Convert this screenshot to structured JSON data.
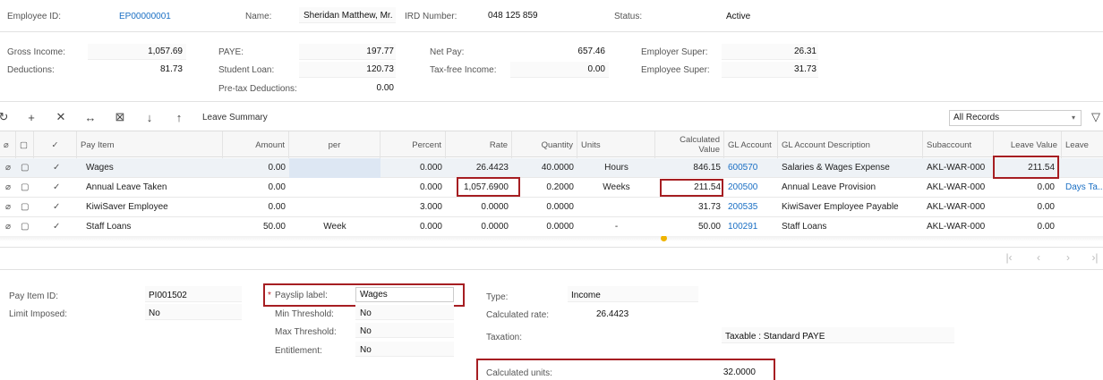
{
  "header": {
    "employee_id_label": "Employee ID:",
    "employee_id": "EP00000001",
    "name_label": "Name:",
    "name": "Sheridan Matthew, Mr.",
    "ird_label": "IRD Number:",
    "ird": "048 125 859",
    "status_label": "Status:",
    "status": "Active"
  },
  "summary": {
    "gross_income_label": "Gross Income:",
    "gross_income": "1,057.69",
    "deductions_label": "Deductions:",
    "deductions": "81.73",
    "paye_label": "PAYE:",
    "paye": "197.77",
    "student_loan_label": "Student Loan:",
    "student_loan": "120.73",
    "pretax_label": "Pre-tax Deductions:",
    "pretax": "0.00",
    "net_pay_label": "Net Pay:",
    "net_pay": "657.46",
    "taxfree_label": "Tax-free Income:",
    "taxfree": "0.00",
    "employer_super_label": "Employer Super:",
    "employer_super": "26.31",
    "employee_super_label": "Employee Super:",
    "employee_super": "31.73"
  },
  "toolbar": {
    "leave_summary": "Leave Summary",
    "records_filter": "All Records"
  },
  "grid": {
    "columns": {
      "pay_item": "Pay Item",
      "amount": "Amount",
      "per": "per",
      "percent": "Percent",
      "rate": "Rate",
      "quantity": "Quantity",
      "units": "Units",
      "calc_value": "Calculated Value",
      "gl_account": "GL Account",
      "gl_desc": "GL Account Description",
      "subaccount": "Subaccount",
      "leave_value": "Leave Value",
      "leave": "Leave"
    },
    "rows": [
      {
        "pay_item": "Wages",
        "amount": "0.00",
        "per": "",
        "percent": "0.000",
        "rate": "26.4423",
        "quantity": "40.0000",
        "units": "Hours",
        "calc_value": "846.15",
        "gl_account": "600570",
        "gl_desc": "Salaries & Wages Expense",
        "subaccount": "AKL-WAR-000",
        "leave_value": "211.54",
        "leave": ""
      },
      {
        "pay_item": "Annual Leave Taken",
        "amount": "0.00",
        "per": "",
        "percent": "0.000",
        "rate": "1,057.6900",
        "quantity": "0.2000",
        "units": "Weeks",
        "calc_value": "211.54",
        "gl_account": "200500",
        "gl_desc": "Annual Leave Provision",
        "subaccount": "AKL-WAR-000",
        "leave_value": "0.00",
        "leave": "Days Ta..."
      },
      {
        "pay_item": "KiwiSaver Employee",
        "amount": "0.00",
        "per": "",
        "percent": "3.000",
        "rate": "0.0000",
        "quantity": "0.0000",
        "units": "",
        "calc_value": "31.73",
        "gl_account": "200535",
        "gl_desc": "KiwiSaver Employee Payable",
        "subaccount": "AKL-WAR-000",
        "leave_value": "0.00",
        "leave": ""
      },
      {
        "pay_item": "Staff Loans",
        "amount": "50.00",
        "per": "Week",
        "percent": "0.000",
        "rate": "0.0000",
        "quantity": "0.0000",
        "units": "-",
        "calc_value": "50.00",
        "gl_account": "100291",
        "gl_desc": "Staff Loans",
        "subaccount": "AKL-WAR-000",
        "leave_value": "0.00",
        "leave": ""
      }
    ]
  },
  "detail": {
    "pay_item_id_label": "Pay Item ID:",
    "pay_item_id": "PI001502",
    "limit_label": "Limit Imposed:",
    "limit": "No",
    "payslip_label_label": "Payslip label:",
    "payslip_label": "Wages",
    "required_mark": "*",
    "min_label": "Min Threshold:",
    "min": "No",
    "max_label": "Max Threshold:",
    "max": "No",
    "entitlement_label": "Entitlement:",
    "entitlement": "No",
    "type_label": "Type:",
    "type": "Income",
    "calc_rate_label": "Calculated rate:",
    "calc_rate": "26.4423",
    "taxation_label": "Taxation:",
    "taxation": "Taxable : Standard PAYE",
    "calc_units_label": "Calculated units:",
    "calc_units": "32.0000"
  },
  "colors": {
    "accent_link": "#1a6fc4",
    "highlight_box": "#a61e22",
    "selected_cell": "#dde7f3"
  }
}
